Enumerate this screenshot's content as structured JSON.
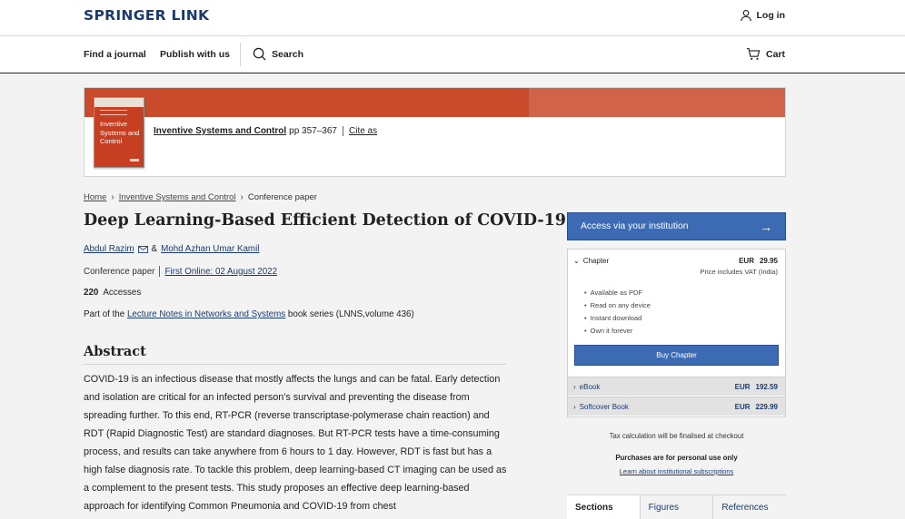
{
  "header": {
    "logo_text": "SPRINGER LINK",
    "login_label": "Log in"
  },
  "nav": {
    "find_journal": "Find a journal",
    "publish": "Publish with us",
    "search": "Search",
    "cart": "Cart"
  },
  "book": {
    "cover_title": "Inventive Systems and Control",
    "title": "Inventive Systems and Control",
    "pages": "pp 357–367",
    "cite_label": "Cite as"
  },
  "breadcrumb": {
    "home": "Home",
    "book": "Inventive Systems and Control",
    "current": "Conference paper"
  },
  "article": {
    "title": "Deep Learning-Based Efficient Detection of COVID-19",
    "author1": "Abdul Razim",
    "author_sep": "&",
    "author2": "Mohd Azhan Umar Kamil",
    "type": "Conference paper",
    "first_online": "First Online: 02 August 2022",
    "accesses_count": "220",
    "accesses_label": "Accesses",
    "part_of_prefix": "Part of the",
    "series_name": "Lecture Notes in Networks and Systems",
    "series_suffix": "book series (LNNS,volume 436)"
  },
  "abstract": {
    "heading": "Abstract",
    "text": "COVID-19 is an infectious disease that mostly affects the lungs and can be fatal. Early detection and isolation are critical for an infected person's survival and preventing the disease from spreading further. To this end, RT-PCR (reverse transcriptase-polymerase chain reaction) and RDT (Rapid Diagnostic Test) are standard diagnoses. But RT-PCR tests have a time-consuming process, and results can take anywhere from 6 hours to 1 day. However, RDT is fast but has a high false diagnosis rate. To tackle this problem, deep learning-based CT imaging can be used as a complement to the present tests. This study proposes an effective deep learning-based approach for identifying Common Pneumonia and COVID-19 from chest"
  },
  "sidebar": {
    "access_button": "Access via your institution",
    "chapter_label": "Chapter",
    "chapter_currency": "EUR",
    "chapter_price": "29.95",
    "vat_note": "Price includes VAT (India)",
    "features": [
      "Available as PDF",
      "Read on any device",
      "Instant download",
      "Own it forever"
    ],
    "buy_button": "Buy Chapter",
    "ebook_label": "eBook",
    "ebook_currency": "EUR",
    "ebook_price": "192.59",
    "softcover_label": "Softcover Book",
    "softcover_currency": "EUR",
    "softcover_price": "229.99",
    "tax_note": "Tax calculation will be finalised at checkout",
    "personal_note": "Purchases are for personal use only",
    "institutional_link": "Learn about institutional subscriptions"
  },
  "tabs": [
    "Sections",
    "Figures",
    "References"
  ],
  "colors": {
    "brand_blue": "#1b3b6f",
    "button_blue": "#3d6bb3",
    "banner_red": "#c94b2c"
  }
}
